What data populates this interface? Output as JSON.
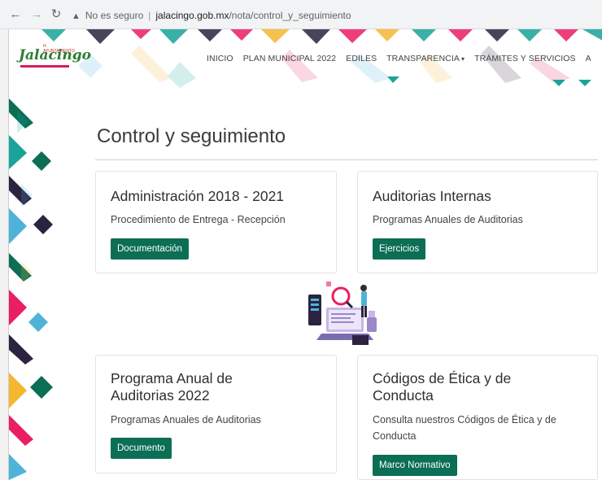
{
  "browser": {
    "security_label": "No es seguro",
    "url_host": "jalacingo.gob.mx",
    "url_path": "/nota/control_y_seguimiento"
  },
  "logo": {
    "text": "Jalacingo",
    "small_text": "H. AYUNTAMIENTO"
  },
  "nav": {
    "items": [
      "INICIO",
      "PLAN MUNICIPAL 2022",
      "EDILES",
      "TRANSPARENCIA",
      "TRÁMITES Y SERVICIOS",
      "A"
    ],
    "dropdown_caret": "▾"
  },
  "page": {
    "title": "Control y seguimiento"
  },
  "cards": [
    {
      "title": "Administración 2018 - 2021",
      "text": "Procedimiento de Entrega - Recepción",
      "button": "Documentación"
    },
    {
      "title": "Auditorias Internas",
      "text": "Programas Anuales de Auditorias",
      "button": "Ejercicios"
    },
    {
      "title_line1": "Programa Anual de",
      "title_line2": "Auditorias 2022",
      "text": "Programas Anuales de Auditorias",
      "button": "Documento"
    },
    {
      "title_line1": "Códigos de Ética y de",
      "title_line2": "Conducta",
      "text_line1": "Consulta nuestros Códigos de Ética y de",
      "text_line2": "Conducta",
      "button": "Marco Normativo"
    }
  ],
  "colors": {
    "brand_green": "#0b6e55",
    "accent_pink": "#e91e63",
    "accent_teal": "#1aa39a",
    "accent_yellow": "#f5b731",
    "accent_dark": "#2b2340",
    "accent_blue": "#4fb3d9"
  },
  "icons": {
    "back": "arrow-left-icon",
    "forward": "arrow-right-icon",
    "reload": "reload-icon",
    "warning": "warning-icon"
  }
}
